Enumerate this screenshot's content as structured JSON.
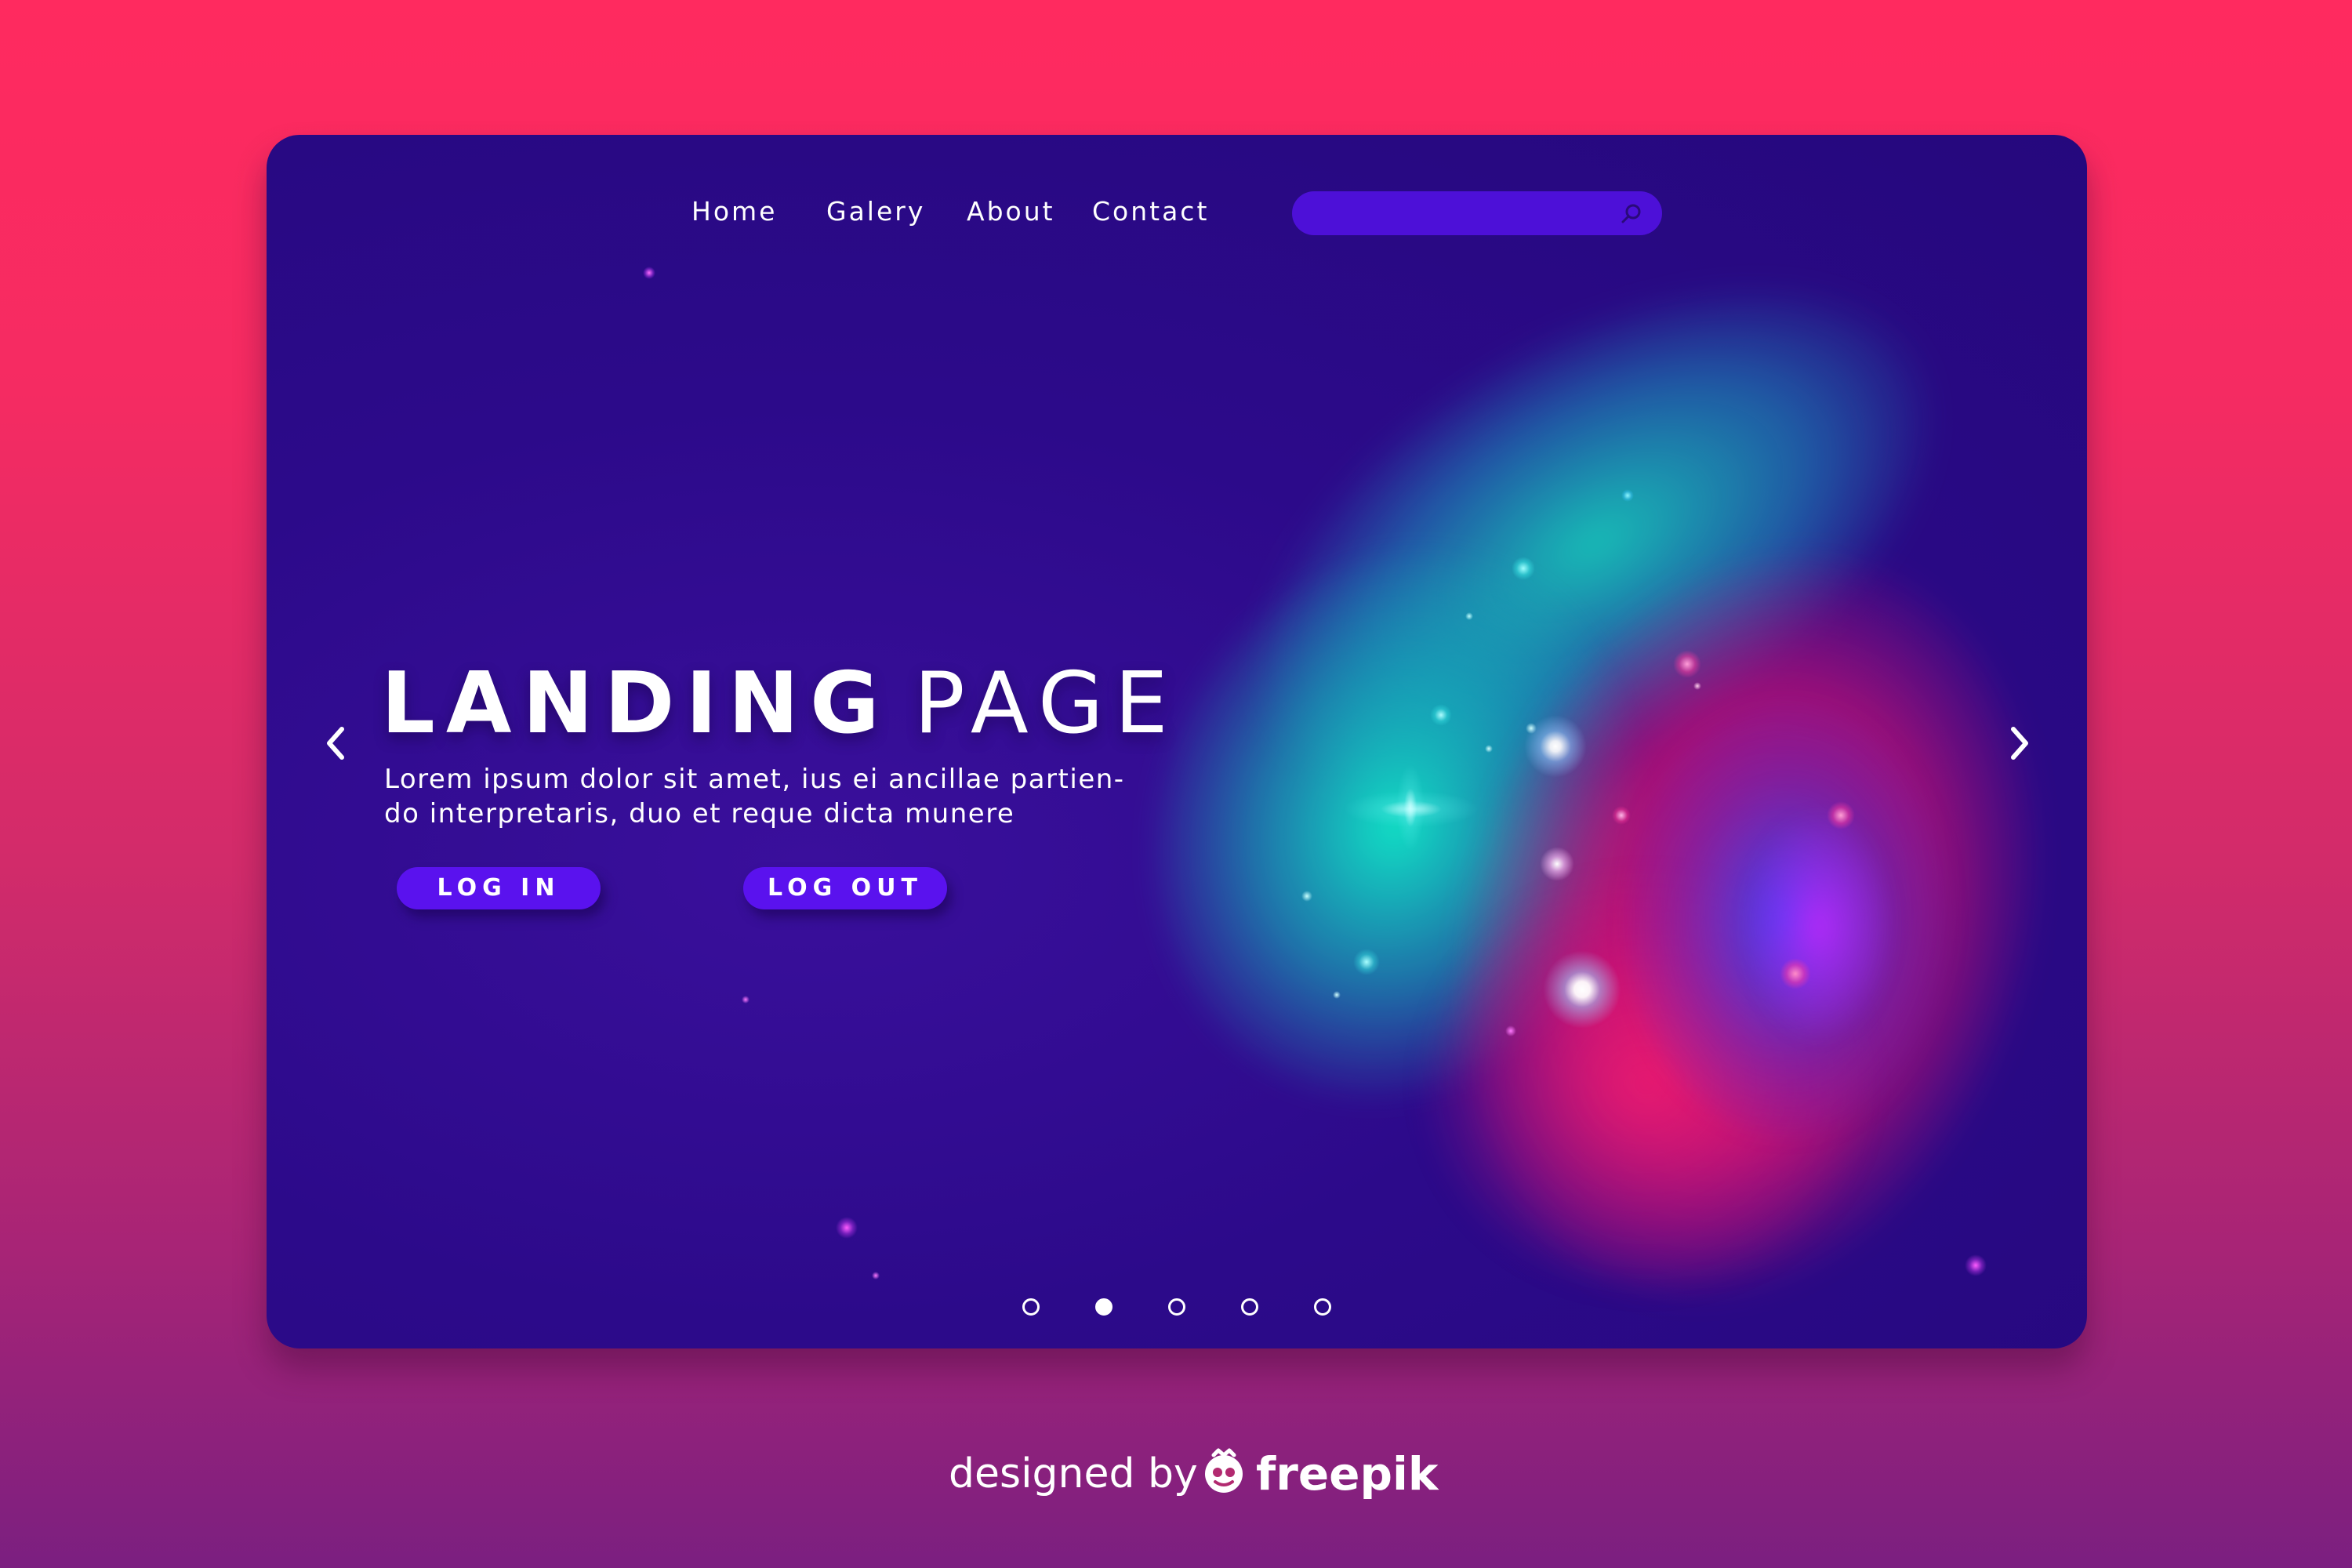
{
  "nav": {
    "links": [
      "Home",
      "Galery",
      "About",
      "Contact"
    ],
    "search": {
      "value": "",
      "placeholder": ""
    }
  },
  "hero": {
    "title_bold": "LANDING",
    "title_light": "PAGE",
    "description_lines": [
      "Lorem ipsum dolor sit amet, ius ei ancillae partien-",
      "do interpretaris, duo et reque dicta munere"
    ],
    "login_label": "LOG IN",
    "logout_label": "LOG OUT"
  },
  "carousel": {
    "slide_count": 5,
    "active_index": 1
  },
  "footer": {
    "designed_by": "designed by",
    "brand": "freepik"
  },
  "colors": {
    "background_top": "#ff2a5f",
    "background_bottom": "#7b1f80",
    "card": "#2c0a8a",
    "button": "#5a12ee",
    "search": "#4d10d8",
    "teal": "#14dcbe",
    "pink": "#ff1464"
  },
  "icons": {
    "search": "search-icon",
    "prev": "chevron-left-icon",
    "next": "chevron-right-icon",
    "brand": "freepik-logo-icon"
  }
}
